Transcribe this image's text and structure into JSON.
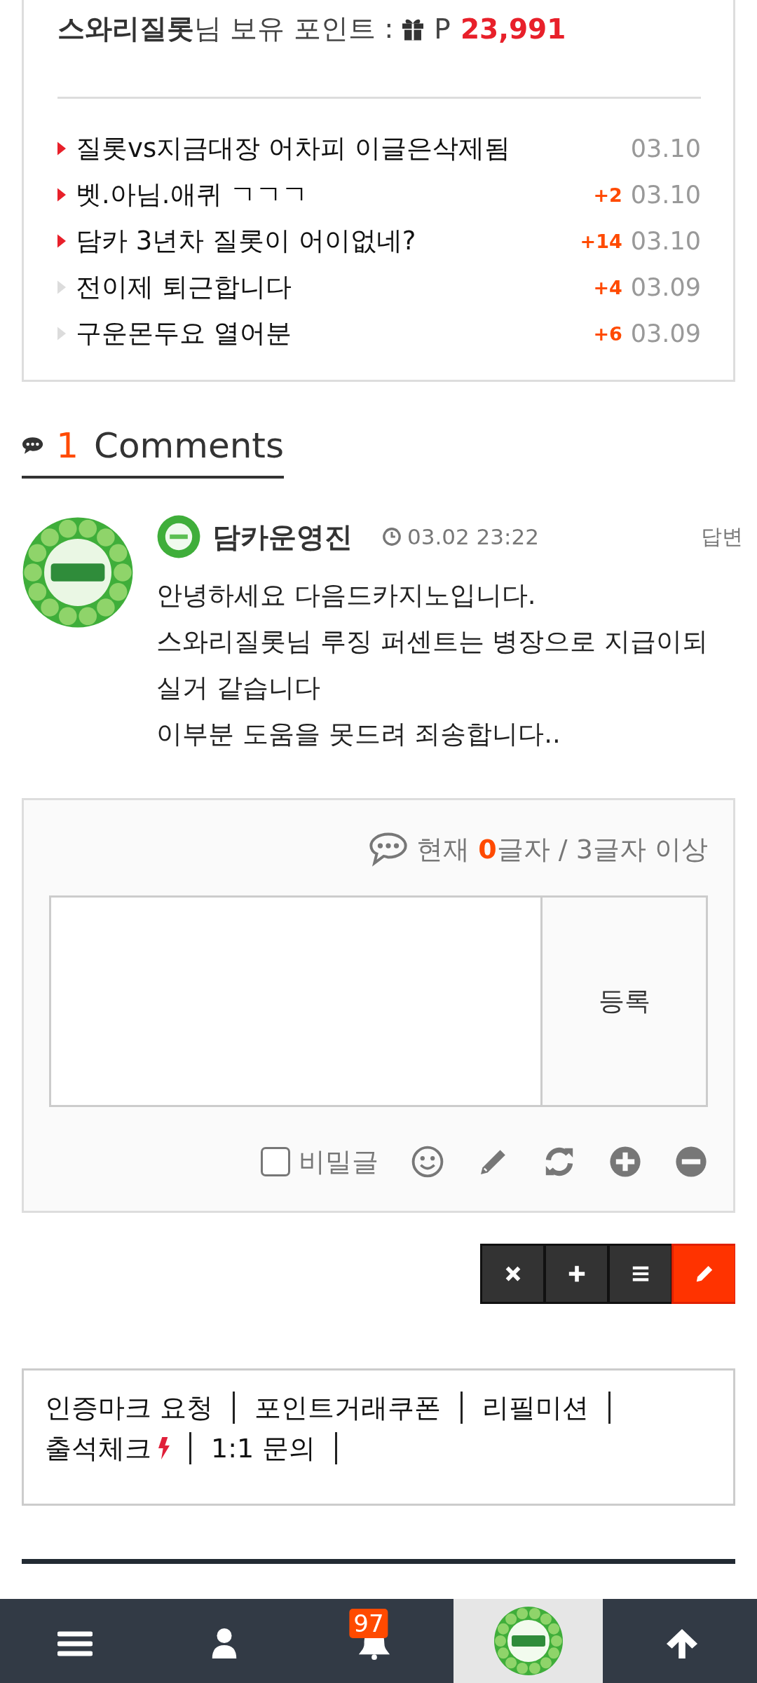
{
  "points": {
    "user": "스와리질롯",
    "suffix": "님 보유 포인트 :",
    "currency": "P",
    "value": "23,991"
  },
  "posts": [
    {
      "title": "질롯vs지금대장 어차피 이글은삭제됨",
      "hot": true,
      "date": "03.10"
    },
    {
      "title": "벳.아님.애퀴 ㄱㄱㄱ",
      "hot": true,
      "count": "+2",
      "date": "03.10"
    },
    {
      "title": "담카 3년차 질롯이 어이없네?",
      "hot": true,
      "count": "+14",
      "date": "03.10"
    },
    {
      "title": "전이제 퇴근합니다",
      "hot": false,
      "count": "+4",
      "date": "03.09"
    },
    {
      "title": "구운몬두요 열어분",
      "hot": false,
      "count": "+6",
      "date": "03.09"
    }
  ],
  "comments_header": {
    "count": "1",
    "label": "Comments"
  },
  "comment": {
    "author": "담카운영진",
    "time": "03.02 23:22",
    "reply": "답변",
    "lines": [
      "안녕하세요 다음드카지노입니다.",
      "스와리질롯님 루징 퍼센트는 병장으로 지급이되",
      "실거 같습니다",
      "이부분 도움을 못드려 죄송합니다.."
    ]
  },
  "form": {
    "counter_prefix": "현재",
    "counter_value": "0",
    "counter_suffix": "글자 / 3글자 이상",
    "submit": "등록",
    "secret": {
      "label": "비밀글",
      "checked": false
    }
  },
  "actions": [
    {
      "kind": "close"
    },
    {
      "kind": "add"
    },
    {
      "kind": "list"
    },
    {
      "kind": "write"
    }
  ],
  "links": [
    {
      "label": "인증마크 요청",
      "hot": false
    },
    {
      "label": "포인트거래쿠폰",
      "hot": false
    },
    {
      "label": "리필미션",
      "hot": false
    },
    {
      "label": "출석체크",
      "hot": true
    },
    {
      "label": "1:1 문의",
      "hot": false
    }
  ],
  "nav": [
    {
      "kind": "menu",
      "selected": false
    },
    {
      "kind": "user",
      "selected": false
    },
    {
      "kind": "bell",
      "badge": "97",
      "selected": false
    },
    {
      "kind": "avatar",
      "selected": true
    },
    {
      "kind": "top",
      "selected": false
    }
  ]
}
